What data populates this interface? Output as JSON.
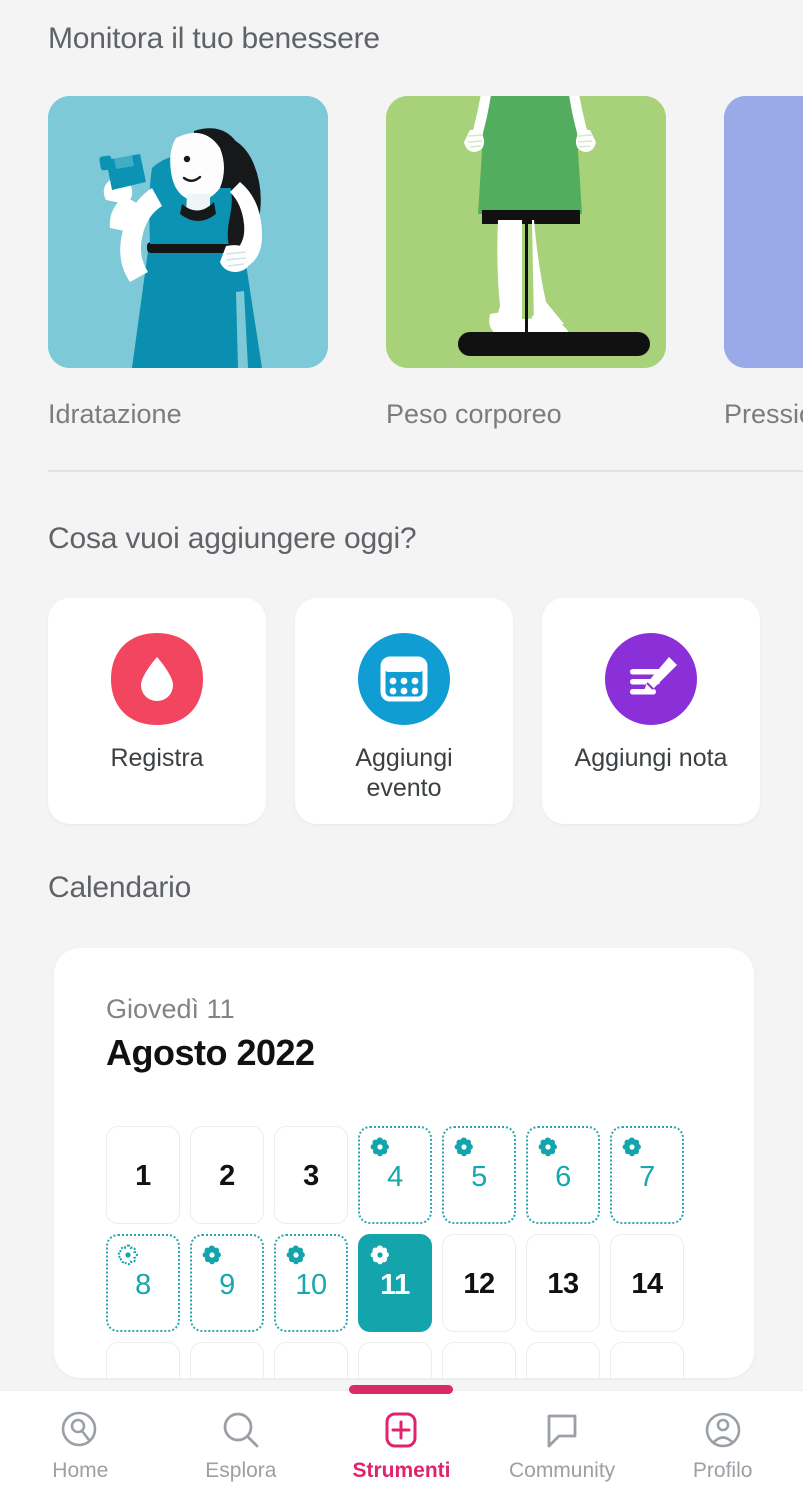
{
  "sections": {
    "monitor_title": "Monitora il tuo benessere",
    "add_title": "Cosa vuoi aggiungere oggi?",
    "calendar_title": "Calendario"
  },
  "wellness": {
    "cards": [
      {
        "label": "Idratazione",
        "art": "woman-drinking-illustration",
        "bg": "#7ec9d8"
      },
      {
        "label": "Peso corporeo",
        "art": "legs-on-scale-illustration",
        "bg": "#a8d27a"
      },
      {
        "label": "Pressione",
        "art": "blood-pressure-illustration",
        "bg": "#9aaae8"
      }
    ]
  },
  "add_actions": {
    "tiles": [
      {
        "label": "Registra",
        "icon": "water-drop-icon",
        "color": "#f2455f"
      },
      {
        "label": "Aggiungi\nevento",
        "icon": "calendar-icon",
        "color": "#109dd4"
      },
      {
        "label": "Aggiungi nota",
        "icon": "note-pencil-icon",
        "color": "#8b30d8"
      }
    ]
  },
  "calendar": {
    "weekday": "Giovedì 11",
    "month_year": "Agosto 2022",
    "selected_day": 11,
    "accent_color": "#13a4ac",
    "days": [
      {
        "n": "1",
        "marked": false,
        "selected": false,
        "flower": "none"
      },
      {
        "n": "2",
        "marked": false,
        "selected": false,
        "flower": "none"
      },
      {
        "n": "3",
        "marked": false,
        "selected": false,
        "flower": "none"
      },
      {
        "n": "4",
        "marked": true,
        "selected": false,
        "flower": "solid"
      },
      {
        "n": "5",
        "marked": true,
        "selected": false,
        "flower": "solid"
      },
      {
        "n": "6",
        "marked": true,
        "selected": false,
        "flower": "solid"
      },
      {
        "n": "7",
        "marked": true,
        "selected": false,
        "flower": "solid"
      },
      {
        "n": "8",
        "marked": true,
        "selected": false,
        "flower": "outline"
      },
      {
        "n": "9",
        "marked": true,
        "selected": false,
        "flower": "solid"
      },
      {
        "n": "10",
        "marked": true,
        "selected": false,
        "flower": "solid"
      },
      {
        "n": "11",
        "marked": false,
        "selected": true,
        "flower": "white"
      },
      {
        "n": "12",
        "marked": false,
        "selected": false,
        "flower": "none"
      },
      {
        "n": "13",
        "marked": false,
        "selected": false,
        "flower": "none"
      },
      {
        "n": "14",
        "marked": false,
        "selected": false,
        "flower": "none"
      },
      {
        "n": "",
        "marked": false,
        "selected": false,
        "flower": "none"
      },
      {
        "n": "",
        "marked": false,
        "selected": false,
        "flower": "none"
      },
      {
        "n": "",
        "marked": false,
        "selected": false,
        "flower": "none"
      },
      {
        "n": "",
        "marked": false,
        "selected": false,
        "flower": "none"
      },
      {
        "n": "",
        "marked": false,
        "selected": false,
        "flower": "none"
      },
      {
        "n": "",
        "marked": false,
        "selected": false,
        "flower": "none"
      },
      {
        "n": "",
        "marked": false,
        "selected": false,
        "flower": "none"
      }
    ]
  },
  "bottom_nav": {
    "active": "Strumenti",
    "active_color": "#e0246b",
    "inactive_color": "#9aa0a6",
    "items": [
      {
        "label": "Home",
        "icon": "home-search-icon"
      },
      {
        "label": "Esplora",
        "icon": "magnifier-icon"
      },
      {
        "label": "Strumenti",
        "icon": "plus-square-icon"
      },
      {
        "label": "Community",
        "icon": "chat-bubble-icon"
      },
      {
        "label": "Profilo",
        "icon": "person-circle-icon"
      }
    ]
  }
}
